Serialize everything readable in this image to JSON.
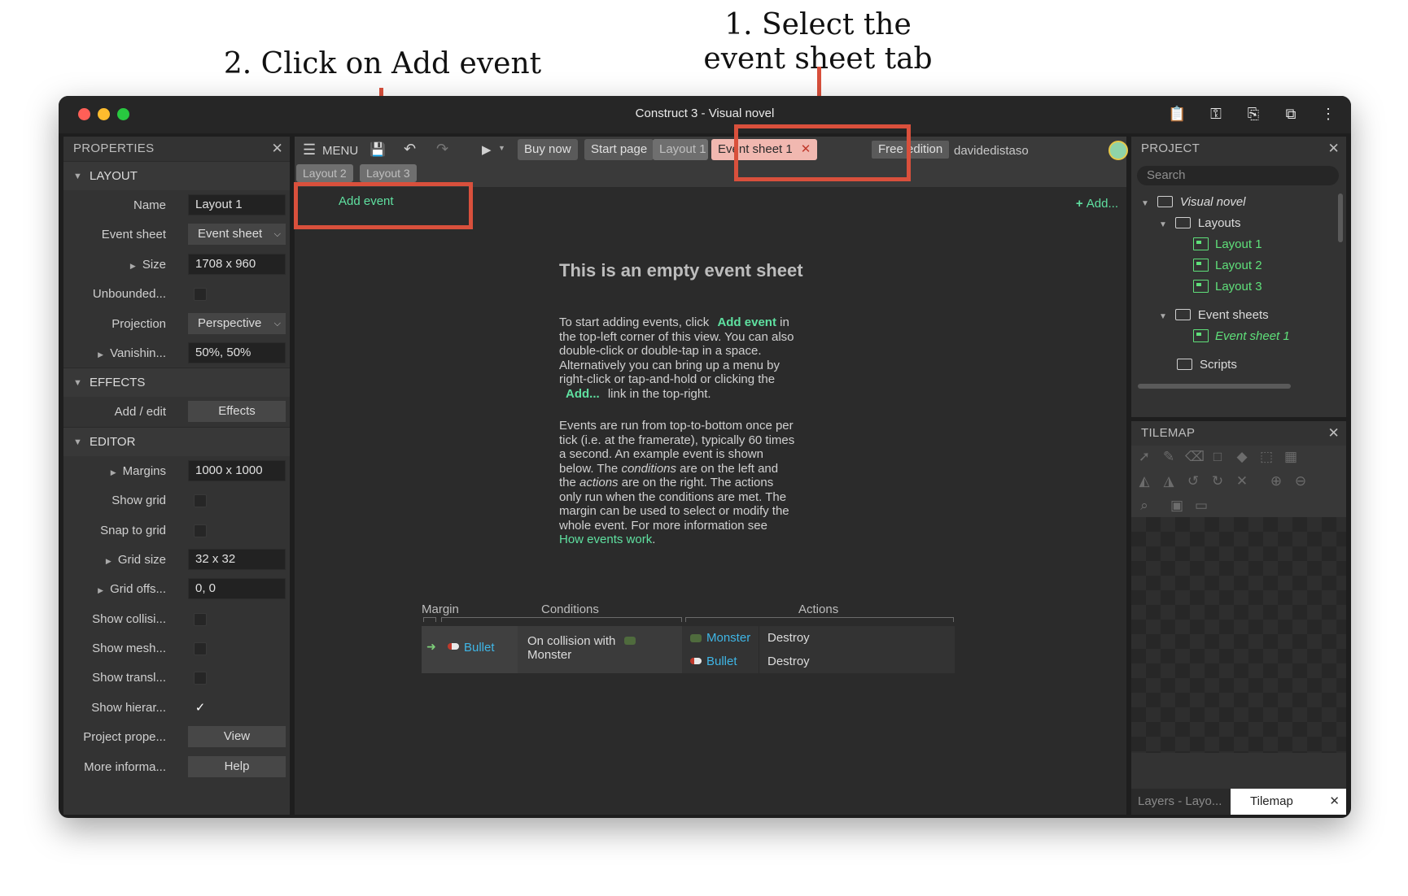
{
  "annotations": {
    "step1": "1. Select the event sheet tab",
    "step2": "2. Click on Add event"
  },
  "window": {
    "title": "Construct 3 - Visual novel"
  },
  "properties": {
    "header": "PROPERTIES",
    "sections": {
      "layout": "LAYOUT",
      "effects": "EFFECTS",
      "editor": "EDITOR"
    },
    "rows": {
      "name_label": "Name",
      "name_value": "Layout 1",
      "eventsheet_label": "Event sheet",
      "eventsheet_value": "Event sheet",
      "size_label": "Size",
      "size_value": "1708 x 960",
      "unbounded_label": "Unbounded...",
      "projection_label": "Projection",
      "projection_value": "Perspective",
      "vanishing_label": "Vanishin...",
      "vanishing_value": "50%, 50%",
      "addedit_label": "Add / edit",
      "effects_button": "Effects",
      "margins_label": "Margins",
      "margins_value": "1000 x 1000",
      "showgrid_label": "Show grid",
      "snap_label": "Snap to grid",
      "gridsize_label": "Grid size",
      "gridsize_value": "32 x 32",
      "gridoffs_label": "Grid offs...",
      "gridoffs_value": "0, 0",
      "showcollisi_label": "Show collisi...",
      "showmesh_label": "Show mesh...",
      "showtransl_label": "Show transl...",
      "showhierar_label": "Show hierar...",
      "projectprope_label": "Project prope...",
      "view_button": "View",
      "moreinfo_label": "More informa...",
      "help_button": "Help"
    }
  },
  "toolbar": {
    "menu": "MENU",
    "buy_now": "Buy now",
    "start_page": "Start page",
    "layout1_tab": "Layout 1",
    "event_sheet_tab": "Event sheet 1",
    "free_edition": "Free edition",
    "username": "davidedistaso"
  },
  "tabs2": {
    "layout2": "Layout 2",
    "layout3": "Layout 3"
  },
  "sheet": {
    "add_event": "Add event",
    "add_link": "Add...",
    "title": "This is an empty event sheet",
    "p1_a": "To start adding events, click",
    "p1_link": "Add event",
    "p1_b": "in the top-left corner of this view. You can also double-click or double-tap in a space. Alternatively you can bring up a menu by right-click or tap-and-hold or clicking the",
    "p1_link2": "Add...",
    "p1_c": "link in the top-right.",
    "p2_a": "Events are run from top-to-bottom once per tick (i.e. at the framerate), typically 60 times a second. An example event is shown below. The",
    "p2_conditions": "conditions",
    "p2_b": "are on the left and the",
    "p2_actions": "actions",
    "p2_c": "are on the right. The actions only run when the conditions are met. The margin can be used to select or modify the whole event. For more information see",
    "p2_link": "How events work",
    "p2_d": ".",
    "example": {
      "margin_header": "Margin",
      "conditions_header": "Conditions",
      "actions_header": "Actions",
      "condition_object": "Bullet",
      "condition_text": "On collision with",
      "condition_target": "Monster",
      "actions": [
        {
          "object": "Monster",
          "action": "Destroy"
        },
        {
          "object": "Bullet",
          "action": "Destroy"
        }
      ]
    }
  },
  "project": {
    "header": "PROJECT",
    "search_placeholder": "Search",
    "root": "Visual novel",
    "layouts_folder": "Layouts",
    "layouts": [
      "Layout 1",
      "Layout 2",
      "Layout 3"
    ],
    "eventsheets_folder": "Event sheets",
    "eventsheets": [
      "Event sheet 1"
    ],
    "scripts_folder": "Scripts"
  },
  "tilemap": {
    "header": "TILEMAP",
    "tab_layers": "Layers - Layo...",
    "tab_tilemap": "Tilemap"
  },
  "colors": {
    "accent_green": "#5fe0a0",
    "highlight_red": "#d9503c",
    "active_tab": "#f1b8b0"
  }
}
